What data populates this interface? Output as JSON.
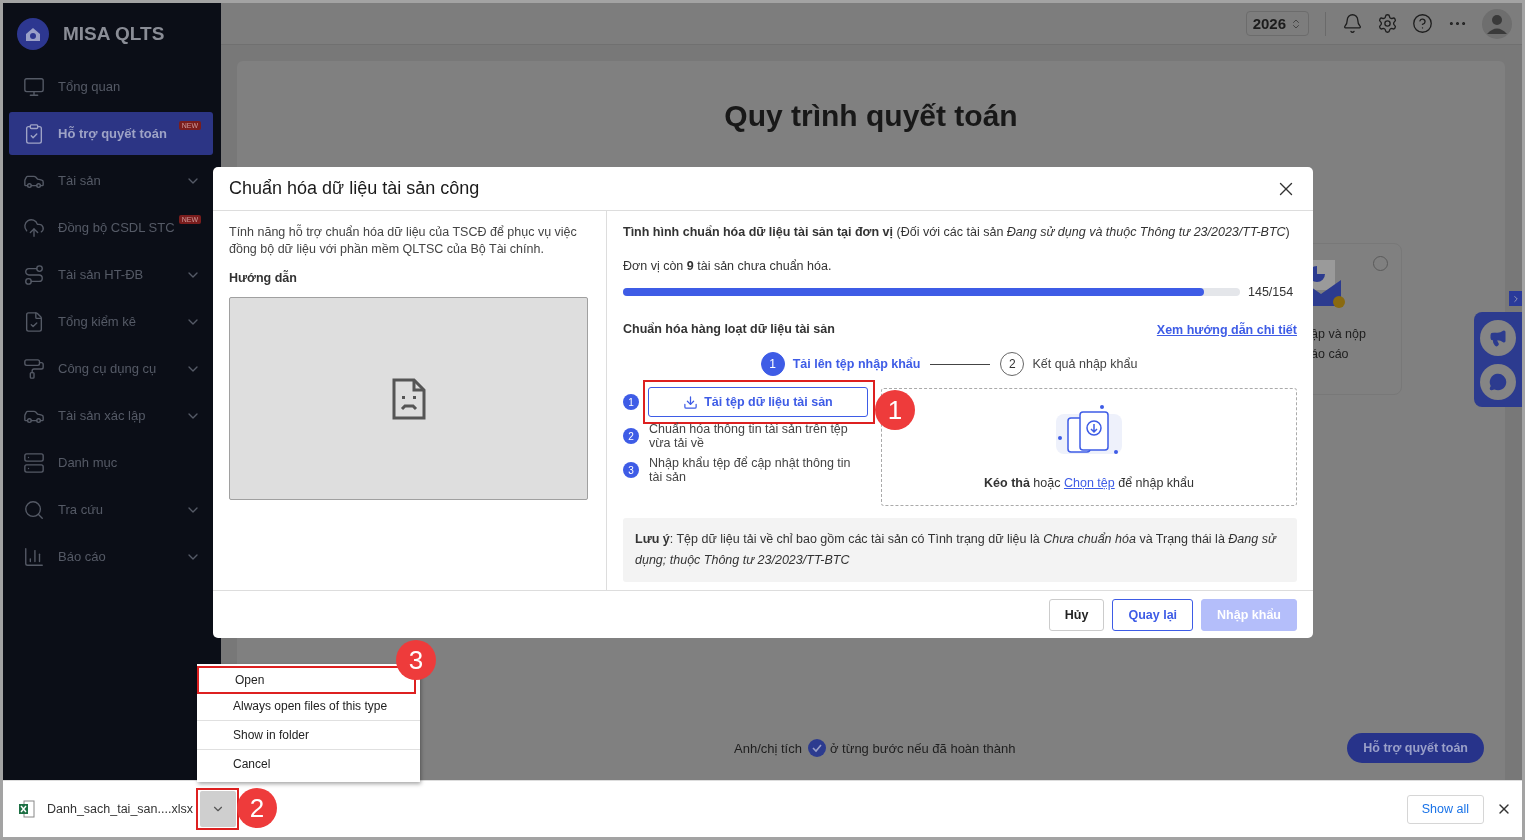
{
  "app": {
    "logo_text": "MISA QLTS"
  },
  "sidebar": {
    "items": [
      {
        "label": "Tổng quan",
        "selected": false,
        "expandable": false
      },
      {
        "label": "Hỗ trợ quyết toán",
        "selected": true,
        "expandable": false,
        "badge": "NEW"
      },
      {
        "label": "Tài sản",
        "selected": false,
        "expandable": true
      },
      {
        "label": "Đồng bộ CSDL STC",
        "selected": false,
        "expandable": false,
        "badge": "NEW"
      },
      {
        "label": "Tài sản HT-ĐB",
        "selected": false,
        "expandable": true
      },
      {
        "label": "Tổng kiểm kê",
        "selected": false,
        "expandable": true
      },
      {
        "label": "Công cụ dụng cụ",
        "selected": false,
        "expandable": true
      },
      {
        "label": "Tài sản xác lập",
        "selected": false,
        "expandable": true
      },
      {
        "label": "Danh mục",
        "selected": false,
        "expandable": false
      },
      {
        "label": "Tra cứu",
        "selected": false,
        "expandable": true
      },
      {
        "label": "Báo cáo",
        "selected": false,
        "expandable": true
      }
    ]
  },
  "top_bar": {
    "year": "2026"
  },
  "page": {
    "title": "Quy trình quyết toán",
    "step_card": {
      "lines": [
        "ập và nộp",
        "áo cáo"
      ],
      "checked": false
    },
    "hint_before": "Anh/chị tích",
    "hint_after": "ở từng bước nếu đã hoàn thành",
    "support_button": "Hỗ trợ quyết toán"
  },
  "dialog": {
    "title": "Chuẩn hóa dữ liệu tài sản công",
    "description": "Tính năng hỗ trợ chuẩn hóa dữ liệu của TSCĐ để phục vụ việc đồng bộ dữ liệu với phần mềm QLTSC của Bộ Tài chính.",
    "guide_label": "Hướng dẫn",
    "status_heading": "**Tình hình chuẩn hóa dữ liệu tài sản tại đơn vị** (Đối với các tài sản *Đang sử dụng và thuộc Thông tư 23/2023/TT-BTC*)",
    "remaining": "Đơn vị còn **9** tài sản chưa chuẩn hóa.",
    "progress": {
      "level": 0.9416,
      "reading": "145/154"
    },
    "batch_heading": "Chuẩn hóa hàng loạt dữ liệu tài sản",
    "guide_link": "Xem hướng dẫn chi tiết",
    "stepper": [
      {
        "number": "1",
        "label": "Tải lên tệp nhập khẩu",
        "selected": true
      },
      {
        "number": "2",
        "label": "Kết quả nhập khẩu",
        "selected": false
      }
    ],
    "tasks": [
      {
        "number": "1",
        "kind": "button",
        "label": "Tải tệp dữ liệu tài sản"
      },
      {
        "number": "2",
        "kind": "text",
        "label": "Chuẩn hóa thông tin tài sản trên tệp vừa tải về"
      },
      {
        "number": "3",
        "kind": "text",
        "label": "Nhập khẩu tệp để cập nhật thông tin tài sản"
      }
    ],
    "drop_zone": {
      "before": "**Kéo thả** hoặc",
      "link": "Chọn tệp",
      "after": "để nhập khẩu"
    },
    "note": "**Lưu ý**: Tệp dữ liệu tải về chỉ bao gồm các tài sản có Tình trạng dữ liệu là *Chưa chuẩn hóa* và Trạng thái là *Đang sử dụng; thuộc Thông tư 23/2023/TT-BTC*",
    "buttons": [
      {
        "label": "Hủy",
        "kind": "default",
        "disabled": false
      },
      {
        "label": "Quay lại",
        "kind": "outline",
        "disabled": false
      },
      {
        "label": "Nhập khẩu",
        "kind": "primary",
        "disabled": true
      }
    ]
  },
  "download_bar": {
    "file_name": "Danh_sach_tai_san....xlsx",
    "show_all": "Show all"
  },
  "context_menu": {
    "groups": [
      {
        "items": [
          "Open",
          "Always open files of this type"
        ]
      },
      {
        "items": [
          "Show in folder"
        ]
      },
      {
        "items": [
          "Cancel"
        ]
      }
    ]
  },
  "callouts": [
    {
      "number": "1"
    },
    {
      "number": "2"
    },
    {
      "number": "3"
    }
  ]
}
